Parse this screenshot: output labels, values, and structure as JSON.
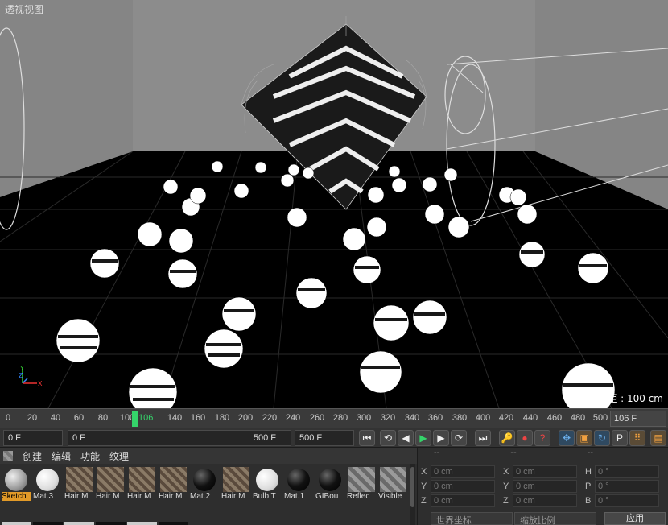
{
  "viewport": {
    "title": "透视视图",
    "status": "网格间距 : 100 cm",
    "axis": {
      "y": "Y",
      "z": "Z",
      "x": "X"
    }
  },
  "timeline": {
    "ticks": [
      "0",
      "20",
      "40",
      "60",
      "80",
      "100",
      "140",
      "160",
      "180",
      "200",
      "220",
      "240",
      "260",
      "280",
      "300",
      "320",
      "340",
      "360",
      "380",
      "400",
      "420",
      "440",
      "460",
      "480",
      "500"
    ],
    "current_frame": "106",
    "end_field": "106 F"
  },
  "transport": {
    "start_field": "0 F",
    "range_start": "0 F",
    "range_end": "500 F",
    "end_field": "500 F",
    "buttons": {
      "first": "⏮",
      "prev_key": "⟲",
      "prev": "◀",
      "play": "▶",
      "next": "▶",
      "next_key": "⟳",
      "last": "⏭",
      "key": "🔑",
      "record": "●",
      "help": "?"
    }
  },
  "materials": {
    "menu": [
      "创建",
      "编辑",
      "功能",
      "纹理"
    ],
    "row1": [
      {
        "label": "Sketch",
        "kind": "gray-ball",
        "selected": true
      },
      {
        "label": "Mat.3",
        "kind": "white-ball"
      },
      {
        "label": "Hair M",
        "kind": "hair"
      },
      {
        "label": "Hair M",
        "kind": "hair"
      },
      {
        "label": "Hair M",
        "kind": "hair"
      },
      {
        "label": "Hair M",
        "kind": "hair"
      },
      {
        "label": "Mat.2",
        "kind": "black-ball"
      },
      {
        "label": "Hair M",
        "kind": "hair"
      },
      {
        "label": "Bulb T",
        "kind": "white-ball"
      },
      {
        "label": "Mat.1",
        "kind": "black-ball"
      },
      {
        "label": "GIBou",
        "kind": "black-ball"
      },
      {
        "label": "Reflec",
        "kind": "striped"
      },
      {
        "label": "Visible",
        "kind": "striped"
      }
    ]
  },
  "attributes": {
    "headers": [
      "--",
      "--",
      "--"
    ],
    "rows": [
      {
        "k1": "X",
        "v1": "0 cm",
        "k2": "X",
        "v2": "0 cm",
        "k3": "H",
        "v3": "0 °"
      },
      {
        "k1": "Y",
        "v1": "0 cm",
        "k2": "Y",
        "v2": "0 cm",
        "k3": "P",
        "v3": "0 °"
      },
      {
        "k1": "Z",
        "v1": "0 cm",
        "k2": "Z",
        "v2": "0 cm",
        "k3": "B",
        "v3": "0 °"
      }
    ],
    "coord_select": "世界坐标",
    "scale_select": "缩放比例",
    "apply": "应用"
  },
  "colors": {
    "accent_green": "#35d46a",
    "selected_orange": "#e29a28"
  }
}
